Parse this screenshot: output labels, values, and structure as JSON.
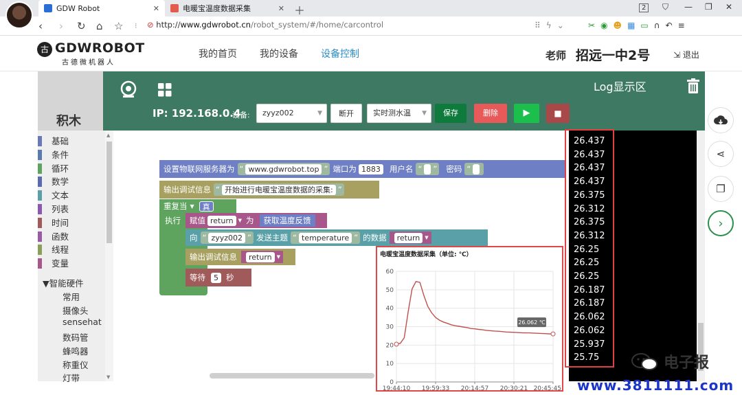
{
  "browser": {
    "tabs": [
      {
        "label": "GDW Robot",
        "active": true
      },
      {
        "label": "电暖宝温度数据采集",
        "active": false
      }
    ],
    "tab_count": "2",
    "url_prefix": "http://",
    "url_host": "www.gdwrobot.cn",
    "url_path": "/robot_system/#/home/carcontrol"
  },
  "site": {
    "logo_badge": "古",
    "logo_text": "GDWROBOT",
    "logo_sub": "古德微机器人",
    "menu": [
      "我的首页",
      "我的设备",
      "设备控制"
    ],
    "active_menu_index": 2,
    "user_role": "老师",
    "user_school": "招远一中2号",
    "logout": "退出"
  },
  "panel": {
    "sidebar_title": "积木",
    "ip_label": "IP: 192.168.0.4",
    "device_label": "设备:",
    "device_value": "zyyz002",
    "disconnect": "断开",
    "mode_value": "实时测水温",
    "save": "保存",
    "delete": "删除",
    "log_title": "Log显示区"
  },
  "categories": [
    {
      "label": "基础",
      "color": "#6a78b8"
    },
    {
      "label": "条件",
      "color": "#5a7ab0"
    },
    {
      "label": "循环",
      "color": "#5ea35e"
    },
    {
      "label": "数学",
      "color": "#5a6ab0"
    },
    {
      "label": "文本",
      "color": "#5aa0a8"
    },
    {
      "label": "列表",
      "color": "#8a5ab0"
    },
    {
      "label": "时间",
      "color": "#a05a5a"
    },
    {
      "label": "函数",
      "color": "#9a5aa6"
    },
    {
      "label": "线程",
      "color": "#8aa05a"
    },
    {
      "label": "变量",
      "color": "#a8578a"
    }
  ],
  "hardware": {
    "title": "▼智能硬件",
    "items": [
      "常用",
      "摄像头",
      "sensehat",
      "数码管",
      "蜂鸣器",
      "称重仪",
      "灯带"
    ]
  },
  "blocks": {
    "iot_server": "设置物联网服务器为",
    "server_value": "www.gdwrobot.top",
    "port_label": "端口为",
    "port_value": "1883",
    "user_label": "用户名",
    "pwd_label": "密码",
    "debug_label": "输出调试信息",
    "debug_text": "开始进行电暖宝温度数据的采集:",
    "repeat_label": "重复当",
    "repeat_value": "真",
    "exec_label": "执行",
    "assign_label": "赋值",
    "assign_var": "return",
    "assign_as": "为",
    "assign_value": "获取温度反馈",
    "send_to": "向",
    "send_dev": "zyyz002",
    "send_topic_label": "发送主题",
    "send_topic": "temperature",
    "send_data_label": "的数据",
    "send_var": "return",
    "debug2_label": "输出调试信息",
    "debug2_var": "return",
    "wait_label": "等待",
    "wait_value": "5",
    "wait_unit": "秒",
    "open_quote": "“",
    "close_quote": "”"
  },
  "log_values": [
    "26.437",
    "26.437",
    "26.437",
    "26.437",
    "26.375",
    "26.312",
    "26.375",
    "26.312",
    "26.25",
    "26.25",
    "26.25",
    "26.187",
    "26.187",
    "26.062",
    "26.062",
    "25.937",
    "25.75"
  ],
  "chart_data": {
    "type": "line",
    "title": "电暖宝温度数据采集（单位: ℃）",
    "x_ticks": [
      "19:44:10",
      "19:59:33",
      "20:14:57",
      "20:30:21",
      "20:45:45"
    ],
    "ylim": [
      0,
      60
    ],
    "y_ticks": [
      0,
      10,
      20,
      30,
      40,
      50,
      60
    ],
    "grid": true,
    "tooltip": "26.062 ℃",
    "series": [
      {
        "color": "#c0504d",
        "x": [
          0,
          1,
          2,
          3,
          4,
          5,
          6,
          7,
          8,
          9,
          10,
          11,
          12,
          13,
          14,
          15,
          16,
          17,
          18,
          19,
          20,
          21,
          22,
          23,
          24,
          25,
          26,
          27,
          28,
          29,
          30,
          31,
          32,
          33,
          34,
          35,
          36,
          37,
          38,
          39,
          40
        ],
        "y": [
          20.5,
          21.0,
          24.0,
          38.0,
          50.5,
          54.5,
          54.0,
          47.0,
          41.0,
          37.5,
          35.0,
          33.5,
          32.5,
          31.8,
          31.0,
          30.5,
          30.2,
          29.8,
          29.5,
          29.0,
          28.8,
          28.5,
          28.3,
          28.0,
          27.8,
          27.6,
          27.5,
          27.3,
          27.1,
          27.0,
          26.9,
          26.8,
          26.7,
          26.6,
          26.6,
          26.5,
          26.4,
          26.3,
          26.2,
          26.1,
          26.06
        ]
      }
    ]
  },
  "right_tools": [
    "cloud-download-icon",
    "share-icon",
    "copy-icon",
    "chevron-right-icon"
  ],
  "watermark": {
    "brand": "电子报",
    "url": "www.3811111.com"
  }
}
